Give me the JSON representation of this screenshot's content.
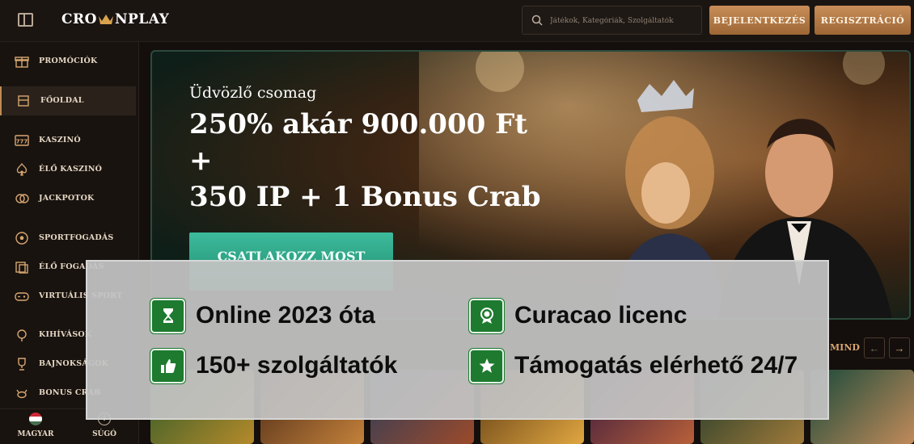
{
  "header": {
    "logo_text_left": "CRO",
    "logo_text_right": "NPLAY",
    "search_placeholder": "Játékok, Kategóriák, Szolgáltatók",
    "login_label": "BEJELENTKEZÉS",
    "register_label": "REGISZTRÁCIÓ"
  },
  "sidebar": {
    "items": [
      {
        "label": "PROMÓCIÓK",
        "icon": "gift-icon"
      },
      {
        "label": "FŐOLDAL",
        "icon": "home-icon",
        "active": true
      },
      {
        "label": "KASZINÓ",
        "icon": "slot-777-icon"
      },
      {
        "label": "ÉLŐ KASZINÓ",
        "icon": "spade-icon"
      },
      {
        "label": "JACKPOTOK",
        "icon": "coins-icon"
      },
      {
        "label": "SPORTFOGADÁS",
        "icon": "soccer-ball-icon"
      },
      {
        "label": "ÉLŐ FOGADÁS",
        "icon": "live-bet-icon"
      },
      {
        "label": "VIRTUÁLIS SPORT",
        "icon": "virtual-sport-icon"
      },
      {
        "label": "KIHÍVÁSOK",
        "icon": "challenge-icon"
      },
      {
        "label": "BAJNOKSÁGOK",
        "icon": "trophy-icon"
      },
      {
        "label": "BONUS CRAB",
        "icon": "crab-icon"
      }
    ],
    "language_label": "MAGYAR",
    "help_label": "SÚGÓ"
  },
  "hero": {
    "eyebrow": "Üdvözlő csomag",
    "title_line1": "250% akár 900.000 Ft",
    "title_line2": "+",
    "title_line3": "350 IP + 1 Bonus Crab",
    "cta_label": "CSATLAKOZZ MOST"
  },
  "section": {
    "see_all_label": "MIND"
  },
  "overlay": {
    "features": [
      {
        "icon": "hourglass-icon",
        "text": "Online 2023 óta"
      },
      {
        "icon": "license-badge-icon",
        "text": "Curacao licenc"
      },
      {
        "icon": "thumbs-up-icon",
        "text": "150+ szolgáltatók"
      },
      {
        "icon": "star-icon",
        "text": "Támogatás elérhető 24/7"
      }
    ],
    "badge_color": "#1d7a2f"
  },
  "colors": {
    "accent_gold": "#c98e59",
    "cta_green": "#2fa586",
    "background": "#140f0c"
  }
}
